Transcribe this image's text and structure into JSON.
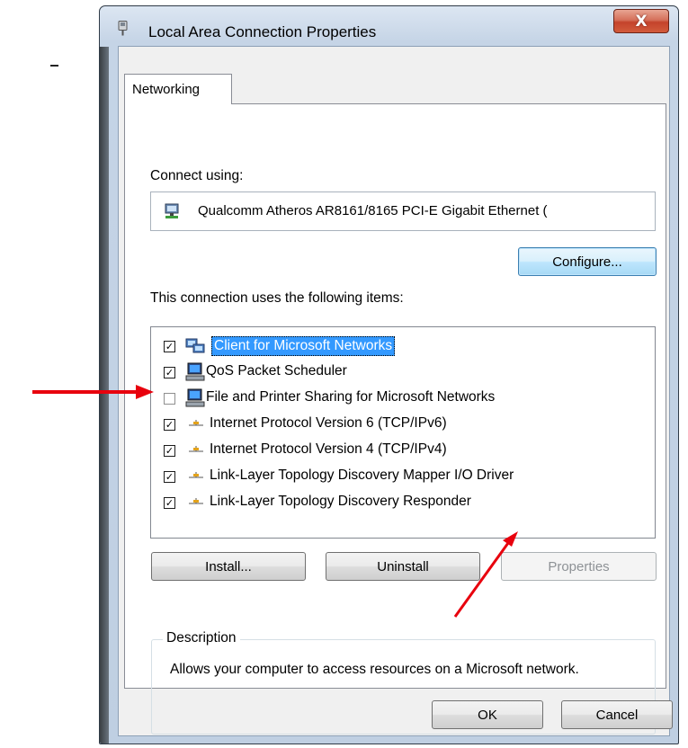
{
  "window": {
    "title": "Local Area Connection Properties",
    "close_label": "X"
  },
  "tabs": [
    {
      "label": "Networking",
      "selected": true
    }
  ],
  "networking": {
    "connect_using_label": "Connect using:",
    "adapter_name": "Qualcomm Atheros AR8161/8165 PCI-E Gigabit Ethernet (",
    "configure_label": "Configure...",
    "items_label": "This connection uses the following items:",
    "items": [
      {
        "label": "Client for Microsoft Networks",
        "checked": true,
        "selected": true,
        "icon": "network-client-icon"
      },
      {
        "label": "QoS Packet Scheduler",
        "checked": true,
        "selected": false,
        "icon": "computer-service-icon"
      },
      {
        "label": "File and Printer Sharing for Microsoft Networks",
        "checked": false,
        "selected": false,
        "icon": "computer-service-icon"
      },
      {
        "label": "Internet Protocol Version 6 (TCP/IPv6)",
        "checked": true,
        "selected": false,
        "icon": "protocol-icon"
      },
      {
        "label": "Internet Protocol Version 4 (TCP/IPv4)",
        "checked": true,
        "selected": false,
        "icon": "protocol-icon"
      },
      {
        "label": "Link-Layer Topology Discovery Mapper I/O Driver",
        "checked": true,
        "selected": false,
        "icon": "protocol-icon"
      },
      {
        "label": "Link-Layer Topology Discovery Responder",
        "checked": true,
        "selected": false,
        "icon": "protocol-icon"
      }
    ],
    "install_label": "Install...",
    "uninstall_label": "Uninstall",
    "properties_label": "Properties",
    "description_legend": "Description",
    "description_text": "Allows your computer to access resources on a Microsoft network."
  },
  "footer": {
    "ok_label": "OK",
    "cancel_label": "Cancel"
  },
  "colors": {
    "annotation_arrow": "#e8000d",
    "selection": "#3399ff"
  }
}
